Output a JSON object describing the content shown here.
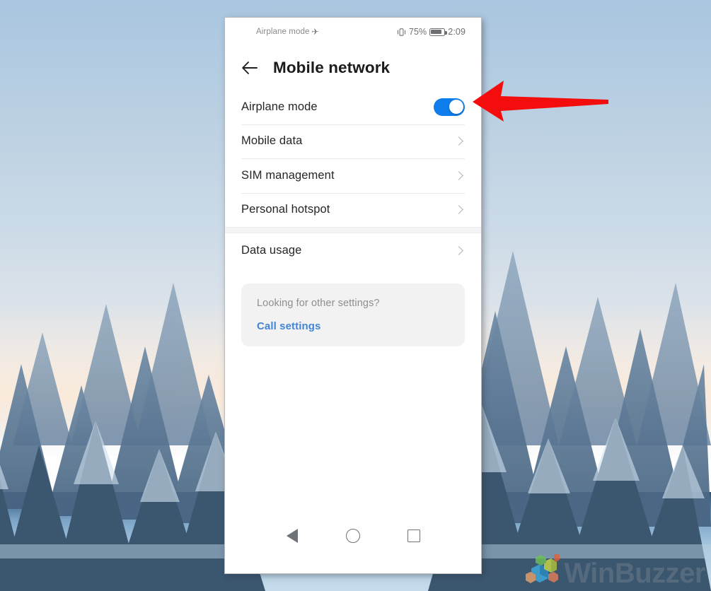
{
  "statusbar": {
    "left_label": "Airplane mode",
    "plane_icon": "airplane-icon",
    "vibrate_icon": "vibrate-icon",
    "battery_percent": "75%",
    "battery_icon": "battery-icon",
    "clock": "2:09"
  },
  "appbar": {
    "back_icon": "back-arrow-icon",
    "title": "Mobile network"
  },
  "settings": {
    "group_one": [
      {
        "label": "Airplane mode",
        "control": "toggle",
        "toggle_state": "on"
      },
      {
        "label": "Mobile data",
        "control": "chevron"
      },
      {
        "label": "SIM management",
        "control": "chevron"
      },
      {
        "label": "Personal hotspot",
        "control": "chevron"
      }
    ],
    "group_two": [
      {
        "label": "Data usage",
        "control": "chevron"
      }
    ]
  },
  "info_card": {
    "title": "Looking for other settings?",
    "link": "Call settings"
  },
  "navbar": {
    "back": "nav-back-button",
    "home": "nav-home-button",
    "recents": "nav-recents-button"
  },
  "annotation": {
    "type": "red-arrow",
    "points_to": "Airplane mode toggle",
    "color": "#f40d0d"
  },
  "watermark": {
    "text": "WinBuzzer"
  },
  "colors": {
    "toggle_on": "#0f7cec",
    "link_blue": "#4285d6",
    "card_bg": "#f2f2f2",
    "divider": "#e9e9e9",
    "title_text": "#1b1b1b",
    "row_text": "#262626",
    "muted_text": "#8e8e90",
    "arrow_red": "#f40d0d"
  }
}
